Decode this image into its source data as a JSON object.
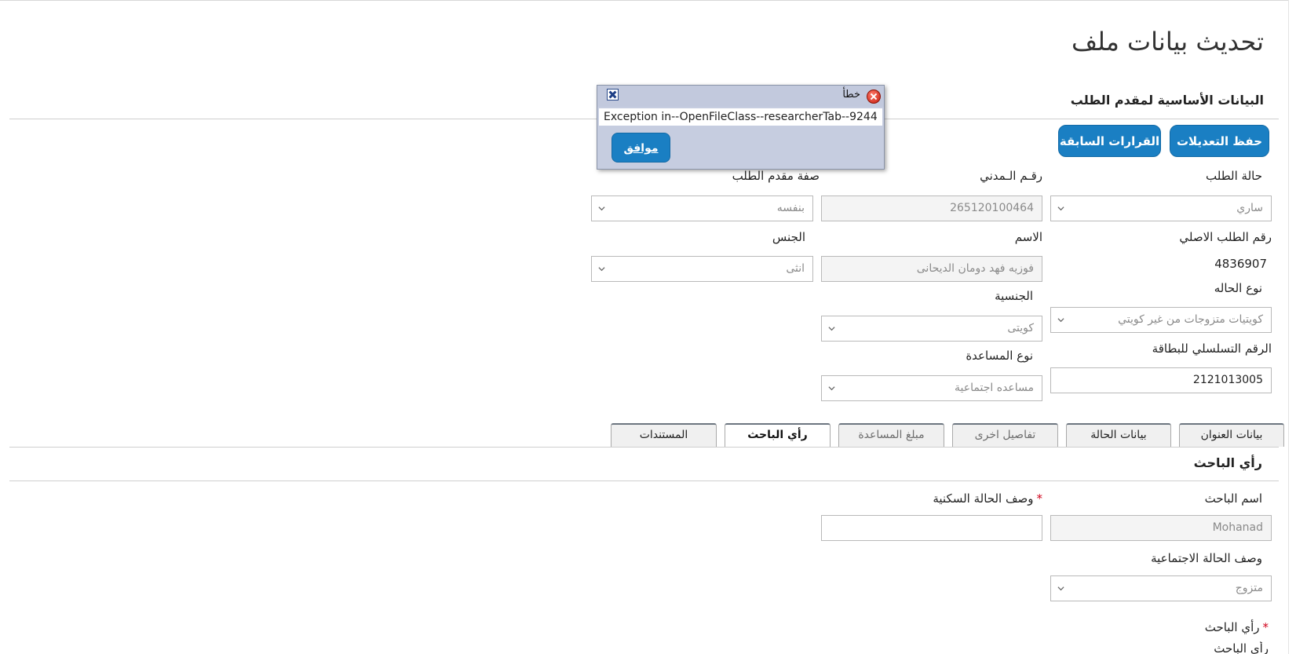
{
  "page": {
    "title": "تحديث بيانات ملف"
  },
  "basic_section": {
    "title": "البيانات الأساسية لمقدم الطلب"
  },
  "buttons": {
    "save": "حفظ التعديلات",
    "previous_decisions": "القرارات السابقة"
  },
  "fields": {
    "request_status": {
      "label": "حالة الطلب",
      "value": "ساري"
    },
    "civil_id": {
      "label": "رقـم الـمدني",
      "value": "265120100464"
    },
    "applicant_role": {
      "label": "صفة مقدم الطلب",
      "value": "بنفسه"
    },
    "original_request_no": {
      "label": "رقم الطلب الاصلي",
      "value": "4836907"
    },
    "name": {
      "label": "الاسم",
      "value": "فوزيه فهد دومان الديحانى"
    },
    "gender": {
      "label": "الجنس",
      "value": "انثى"
    },
    "case_type": {
      "label": "نوع الحاله",
      "value": "كويتيات متزوجات من غير كويتي"
    },
    "nationality": {
      "label": "الجنسية",
      "value": "كويتى"
    },
    "card_serial": {
      "label": "الرقم التسلسلي للبطاقة",
      "value": "2121013005"
    },
    "aid_type": {
      "label": "نوع المساعدة",
      "value": "مساعده اجتماعية"
    }
  },
  "tabs": [
    {
      "label": "بيانات العنوان"
    },
    {
      "label": "بيانات الحالة"
    },
    {
      "label": "تفاصيل اخرى"
    },
    {
      "label": "مبلغ المساعدة"
    },
    {
      "label": "رأي الباحث"
    },
    {
      "label": "المستندات"
    }
  ],
  "researcher_section": {
    "title": "رأي الباحث",
    "researcher_name": {
      "label": "اسم الباحث",
      "value": "Mohanad"
    },
    "housing_desc": {
      "label": "وصف الحالة السكنية",
      "required_mark": "*",
      "value": ""
    },
    "social_desc": {
      "label": "وصف الحالة الاجتماعية",
      "value": "متزوج"
    },
    "researcher_opinion": {
      "label": "رأي الباحث",
      "required_mark": "*"
    },
    "researcher_opinion_sub": {
      "label": "رأي الباحث"
    }
  },
  "dialog": {
    "title": "خطأ",
    "message": "Exception in--OpenFileClass--researcherTab--9244",
    "ok": "موافق",
    "icons": {
      "error": "error-icon",
      "close": "close-icon"
    }
  },
  "colors": {
    "primary": "#1a7fc3",
    "dialog_bg": "#c6cde0",
    "required": "#d0021b"
  }
}
